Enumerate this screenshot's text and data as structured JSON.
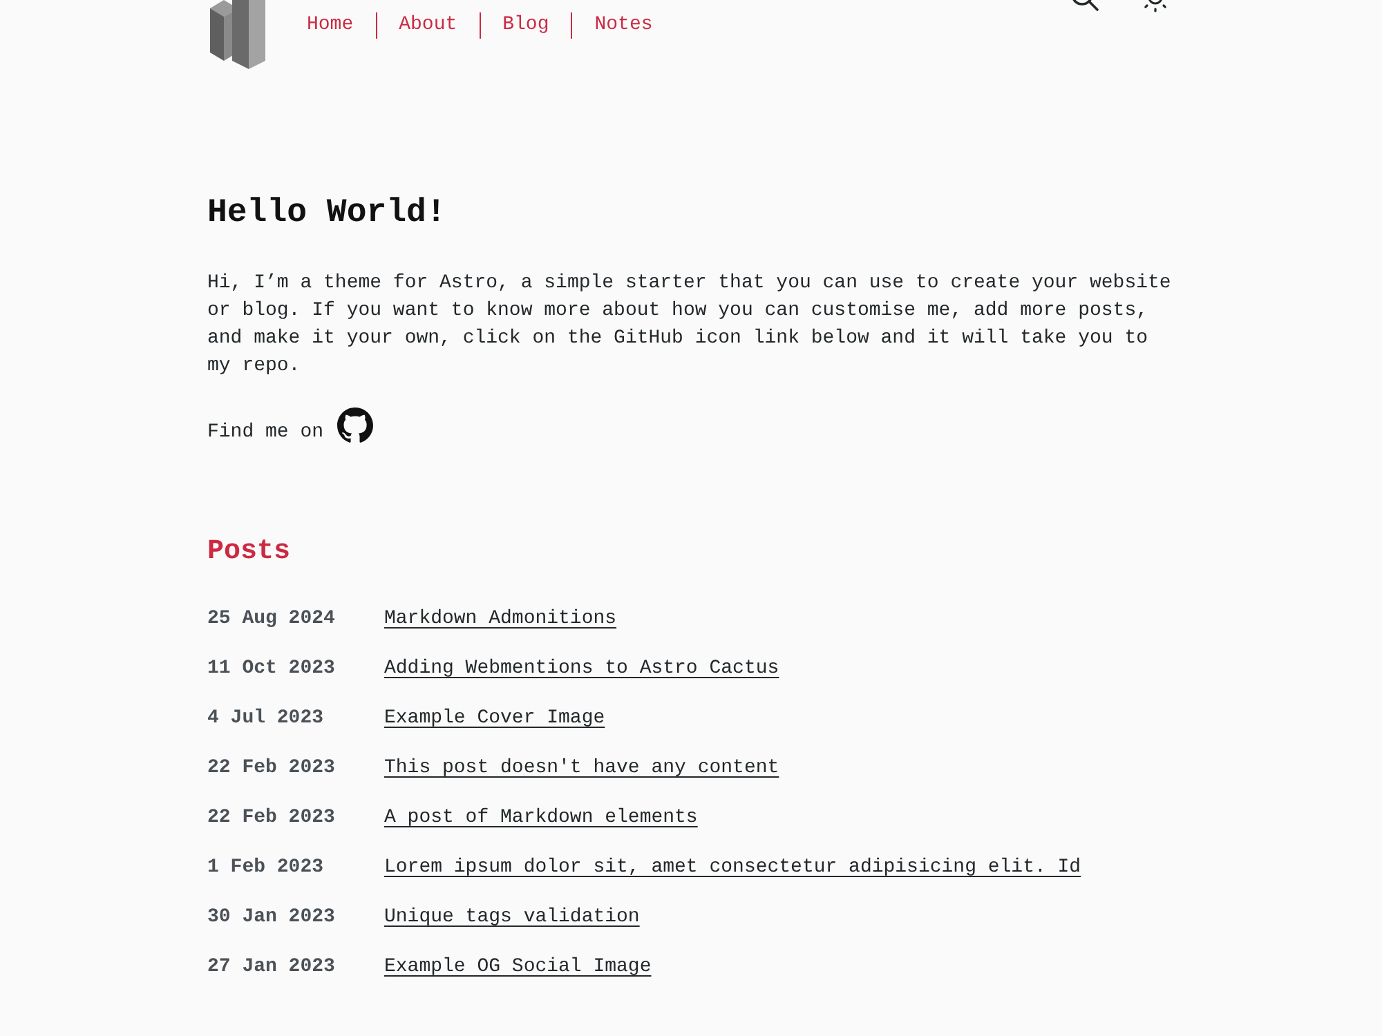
{
  "header": {
    "nav": [
      {
        "label": "Home"
      },
      {
        "label": "About"
      },
      {
        "label": "Blog"
      },
      {
        "label": "Notes"
      }
    ]
  },
  "intro": {
    "title": "Hello World!",
    "text": "Hi, I’m a theme for Astro, a simple starter that you can use to create your website or blog. If you want to know more about how you can customise me, add more posts, and make it your own, click on the GitHub icon link below and it will take you to my repo.",
    "find_me": "Find me on"
  },
  "posts": {
    "title": "Posts",
    "items": [
      {
        "date": "25 Aug 2024",
        "title": "Markdown Admonitions"
      },
      {
        "date": "11 Oct 2023",
        "title": "Adding Webmentions to Astro Cactus"
      },
      {
        "date": "4 Jul 2023",
        "title": "Example Cover Image"
      },
      {
        "date": "22 Feb 2023",
        "title": "This post doesn't have any content"
      },
      {
        "date": "22 Feb 2023",
        "title": "A post of Markdown elements"
      },
      {
        "date": "1 Feb 2023",
        "title": "Lorem ipsum dolor sit, amet consectetur adipisicing elit. Id"
      },
      {
        "date": "30 Jan 2023",
        "title": "Unique tags validation"
      },
      {
        "date": "27 Jan 2023",
        "title": "Example OG Social Image"
      }
    ]
  }
}
